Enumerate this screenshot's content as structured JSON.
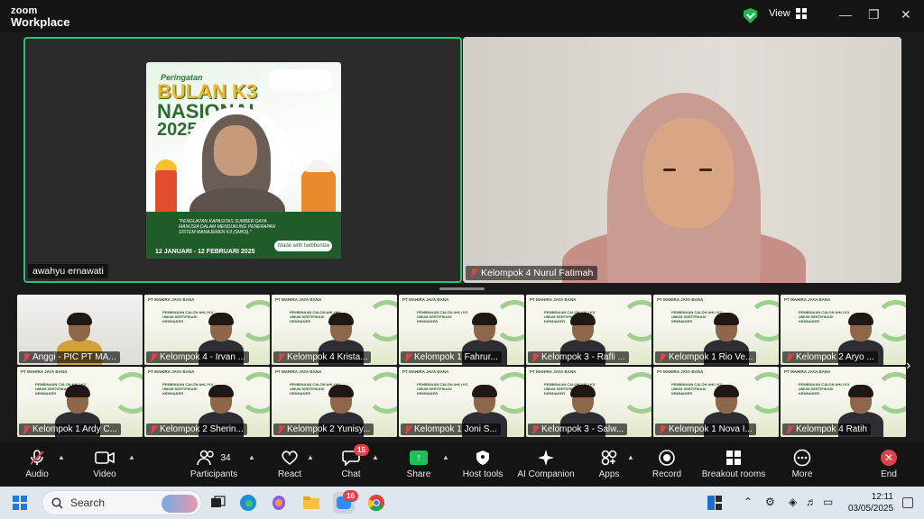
{
  "app": {
    "brand_top": "zoom",
    "brand_bottom": "Workplace",
    "view_label": "View"
  },
  "speakers": {
    "left": {
      "name": "awahyu ernawati",
      "poster": {
        "line1": "Peringatan",
        "line2": "BULAN K3",
        "line3": "NASIONAL",
        "line4": "2025",
        "tagline": "\"PENGUATAN KAPASITAS SUMBER DAYA MANUSIA DALAM MENDUKUNG PENERAPAN SISTEM MANAJEMEN K3 (SMK3).\"",
        "dates": "12 JANUARI - 12 FEBRUARI 2025",
        "made_with": "Made with twibbonize"
      }
    },
    "right": {
      "name": "Kelompok 4 Nurul Fatimah"
    }
  },
  "gallery": [
    {
      "name": "Anggi - PIC PT MA...",
      "kind": "camera"
    },
    {
      "name": "Kelompok 4 - Irvan ...",
      "kind": "slide"
    },
    {
      "name": "Kelompok 4 Krista...",
      "kind": "slide"
    },
    {
      "name": "Kelompok 1 Fahrur...",
      "kind": "slide"
    },
    {
      "name": "Kelompok 3 - Rafli ...",
      "kind": "slide"
    },
    {
      "name": "Kelompok 1 Rio Ve...",
      "kind": "slide"
    },
    {
      "name": "Kelompok 2 Aryo ...",
      "kind": "slide"
    },
    {
      "name": "Kelompok 1 Ardy C...",
      "kind": "slide"
    },
    {
      "name": "Kelompok 2 Sherin...",
      "kind": "slide"
    },
    {
      "name": "Kelompok 2 Yunisy...",
      "kind": "slide"
    },
    {
      "name": "Kelompok 1 Joni S...",
      "kind": "slide"
    },
    {
      "name": "Kelompok 3 - Salw...",
      "kind": "slide"
    },
    {
      "name": "Kelompok 1 Nova I...",
      "kind": "slide"
    },
    {
      "name": "Kelompok 4 Ratih",
      "kind": "slide"
    }
  ],
  "slide_text": {
    "header": "PT MAHIRA JAYA BANA",
    "body": "PEMBINAAN CALON AHLI K3 UMUM SERTIFIKASI KEMNAKER"
  },
  "toolbar": {
    "audio": "Audio",
    "video": "Video",
    "participants": "Participants",
    "participants_count": "34",
    "react": "React",
    "chat": "Chat",
    "chat_badge": "15",
    "share": "Share",
    "host_tools": "Host tools",
    "ai_companion": "AI Companion",
    "apps": "Apps",
    "record": "Record",
    "breakout_rooms": "Breakout rooms",
    "more": "More",
    "end": "End"
  },
  "taskbar": {
    "search_placeholder": "Search",
    "zoom_badge": "16",
    "time": "12:11",
    "date": "03/05/2025"
  },
  "colors": {
    "active_speaker_border": "#2ec46f",
    "end_red": "#e0424a",
    "share_green": "#1dbf5a"
  }
}
